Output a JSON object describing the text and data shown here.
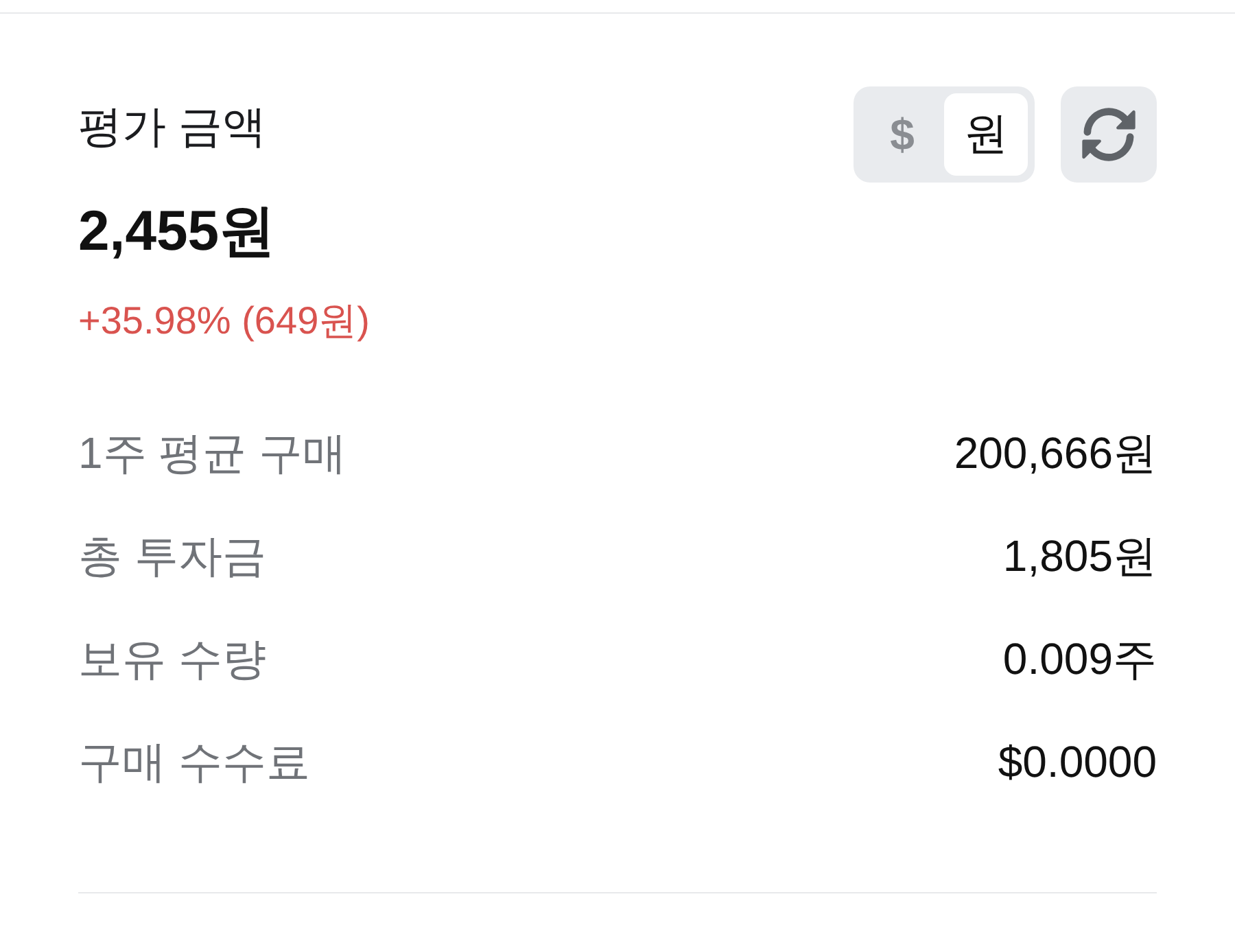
{
  "header": {
    "title": "평가 금액",
    "currency_toggle": [
      {
        "label": "$",
        "selected": false
      },
      {
        "label": "원",
        "selected": true
      }
    ]
  },
  "amount": "2,455원",
  "change": "+35.98% (649원)",
  "details": [
    {
      "label": "1주 평균 구매",
      "value": "200,666원"
    },
    {
      "label": "총 투자금",
      "value": "1,805원"
    },
    {
      "label": "보유 수량",
      "value": "0.009주"
    },
    {
      "label": "구매 수수료",
      "value": "$0.0000"
    }
  ]
}
